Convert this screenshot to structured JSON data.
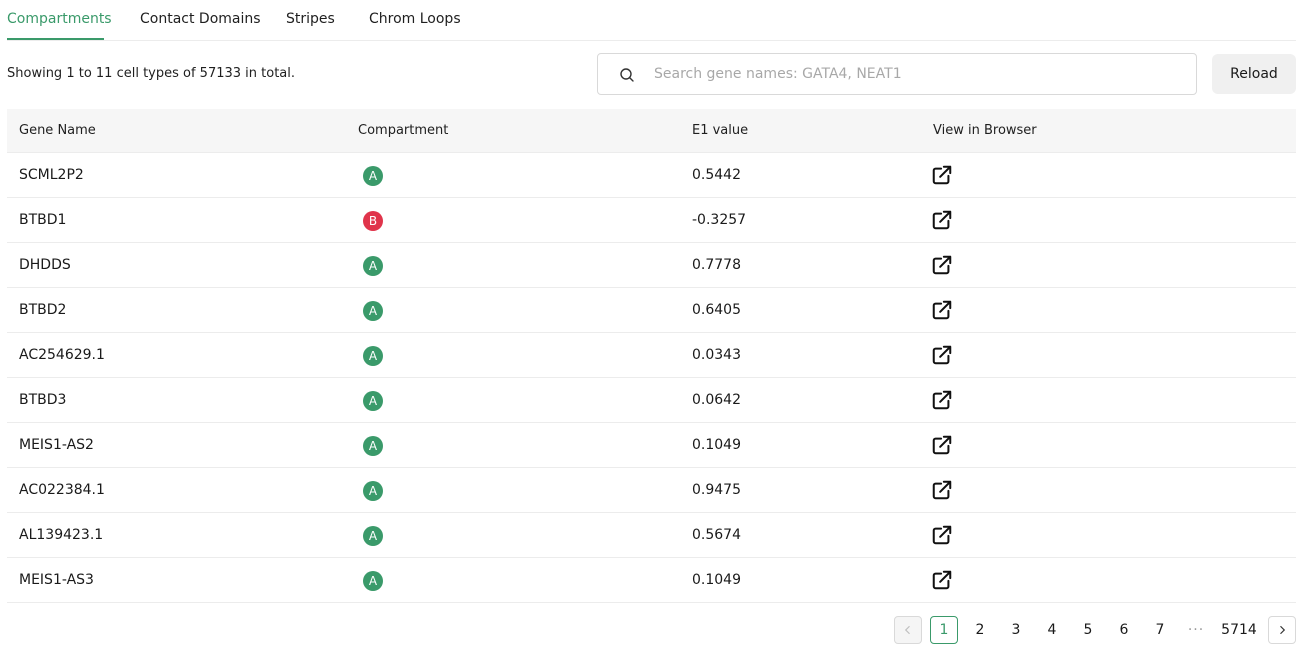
{
  "tabs": [
    {
      "label": "Compartments",
      "active": true
    },
    {
      "label": "Contact Domains",
      "active": false
    },
    {
      "label": "Stripes",
      "active": false
    },
    {
      "label": "Chrom Loops",
      "active": false
    }
  ],
  "summary": "Showing 1 to 11 cell types of 57133 in total.",
  "search": {
    "placeholder": "Search gene names: GATA4, NEAT1",
    "value": "",
    "icon": "search-icon"
  },
  "reload_label": "Reload",
  "table": {
    "headers": [
      "Gene Name",
      "Compartment",
      "E1 value",
      "View in Browser"
    ],
    "rows": [
      {
        "gene": "SCML2P2",
        "compartment": "A",
        "e1": "0.5442"
      },
      {
        "gene": "BTBD1",
        "compartment": "B",
        "e1": "-0.3257"
      },
      {
        "gene": "DHDDS",
        "compartment": "A",
        "e1": "0.7778"
      },
      {
        "gene": "BTBD2",
        "compartment": "A",
        "e1": "0.6405"
      },
      {
        "gene": "AC254629.1",
        "compartment": "A",
        "e1": "0.0343"
      },
      {
        "gene": "BTBD3",
        "compartment": "A",
        "e1": "0.0642"
      },
      {
        "gene": "MEIS1-AS2",
        "compartment": "A",
        "e1": "0.1049"
      },
      {
        "gene": "AC022384.1",
        "compartment": "A",
        "e1": "0.9475"
      },
      {
        "gene": "AL139423.1",
        "compartment": "A",
        "e1": "0.5674"
      },
      {
        "gene": "MEIS1-AS3",
        "compartment": "A",
        "e1": "0.1049"
      }
    ]
  },
  "compartment_colors": {
    "A": "#3a9a6a",
    "B": "#e0344b"
  },
  "accent_color": "#3a9a6a",
  "pagination": {
    "pages": [
      "1",
      "2",
      "3",
      "4",
      "5",
      "6",
      "7"
    ],
    "ellipsis": "···",
    "last": "5714",
    "current": "1",
    "prev_icon": "chevron-left-icon",
    "next_icon": "chevron-right-icon"
  }
}
